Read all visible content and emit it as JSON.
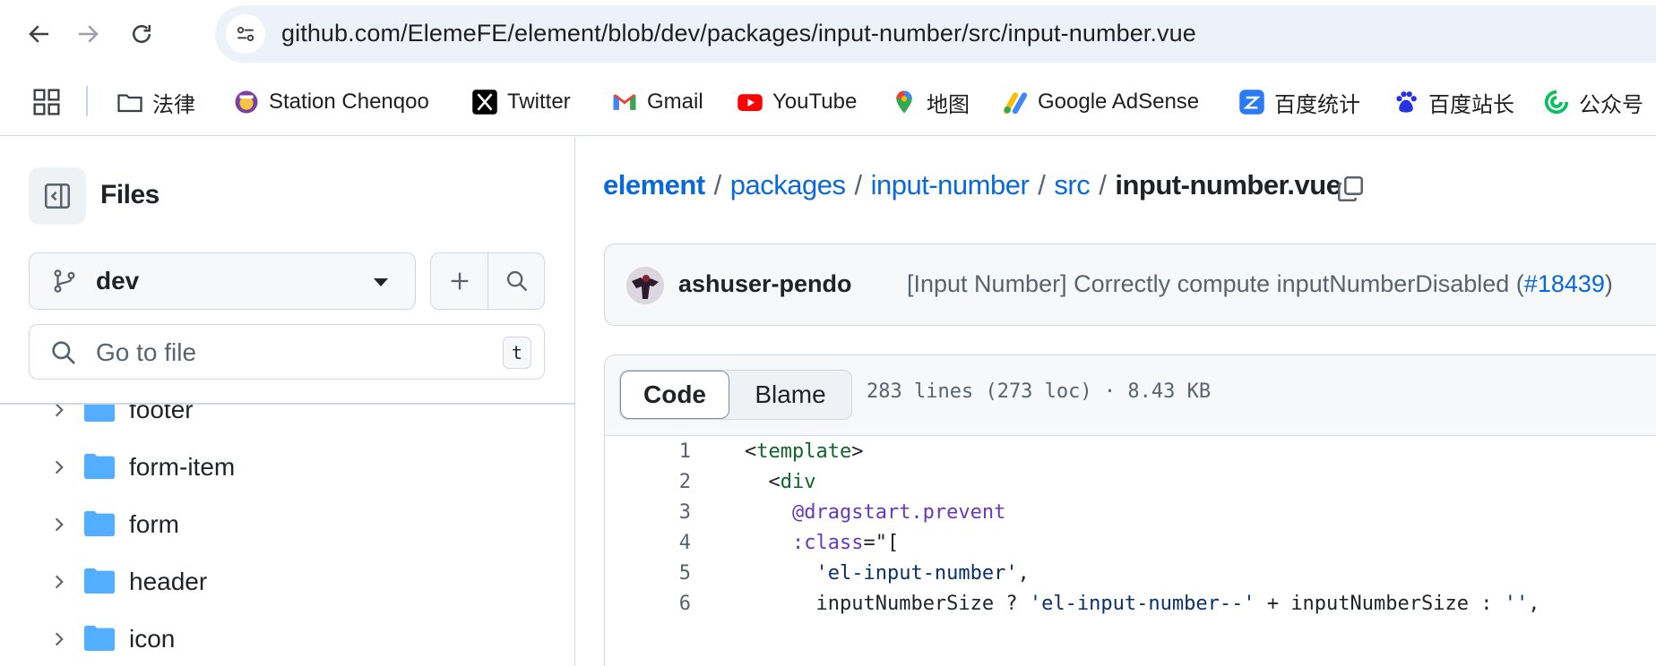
{
  "browser": {
    "url": "github.com/ElemeFE/element/blob/dev/packages/input-number/src/input-number.vue",
    "bookmarks": [
      {
        "label": "法律",
        "icon": "folder-icon"
      },
      {
        "label": "Station Chenqoo",
        "icon": "station-chenqoo-icon"
      },
      {
        "label": "Twitter",
        "icon": "x-twitter-icon"
      },
      {
        "label": "Gmail",
        "icon": "gmail-icon"
      },
      {
        "label": "YouTube",
        "icon": "youtube-icon"
      },
      {
        "label": "地图",
        "icon": "maps-pin-icon"
      },
      {
        "label": "Google AdSense",
        "icon": "adsense-icon"
      },
      {
        "label": "百度统计",
        "icon": "baidu-tongji-icon"
      },
      {
        "label": "百度站长",
        "icon": "baidu-paw-icon"
      },
      {
        "label": "公众号",
        "icon": "wechat-public-icon"
      }
    ]
  },
  "sidebar": {
    "title": "Files",
    "branch": "dev",
    "goto_placeholder": "Go to file",
    "goto_shortcut": "t",
    "tree": [
      "footer",
      "form-item",
      "form",
      "header",
      "icon"
    ]
  },
  "breadcrumb": {
    "root": "element",
    "parts": [
      "packages",
      "input-number",
      "src"
    ],
    "file": "input-number.vue",
    "separator": "/"
  },
  "commit": {
    "author": "ashuser-pendo",
    "message_prefix": "[Input Number] Correctly compute inputNumberDisabled (",
    "pr": "#18439",
    "message_suffix": ")"
  },
  "file": {
    "tab_code": "Code",
    "tab_blame": "Blame",
    "meta": "283 lines (273 loc) · 8.43 KB",
    "lines": [
      {
        "n": "1",
        "text": "<template>"
      },
      {
        "n": "2",
        "text": "  <div"
      },
      {
        "n": "3",
        "text": "    @dragstart.prevent"
      },
      {
        "n": "4",
        "text": "    :class=\"["
      },
      {
        "n": "5",
        "text": "      'el-input-number',"
      },
      {
        "n": "6",
        "text": "      inputNumberSize ? 'el-input-number--' + inputNumberSize : '',"
      }
    ]
  },
  "colors": {
    "link": "#0969da",
    "border": "#d0d7de",
    "folder": "#54aeff",
    "omnibox": "#edf2fa"
  }
}
